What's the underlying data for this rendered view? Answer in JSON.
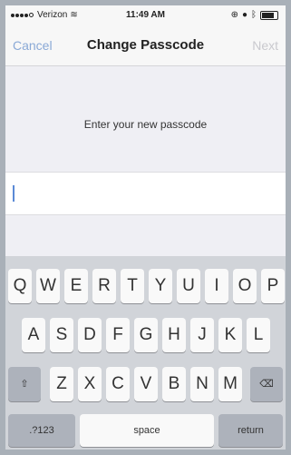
{
  "status_bar": {
    "carrier": "Verizon",
    "time": "11:49 AM"
  },
  "nav": {
    "cancel": "Cancel",
    "title": "Change Passcode",
    "next": "Next"
  },
  "prompt": "Enter your new passcode",
  "keyboard": {
    "row1": [
      "Q",
      "W",
      "E",
      "R",
      "T",
      "Y",
      "U",
      "I",
      "O",
      "P"
    ],
    "row2": [
      "A",
      "S",
      "D",
      "F",
      "G",
      "H",
      "J",
      "K",
      "L"
    ],
    "row3": [
      "Z",
      "X",
      "C",
      "V",
      "B",
      "N",
      "M"
    ],
    "shift": "⇧",
    "delete": "⌫",
    "numbers": ".?123",
    "space": "space",
    "return": "return"
  }
}
